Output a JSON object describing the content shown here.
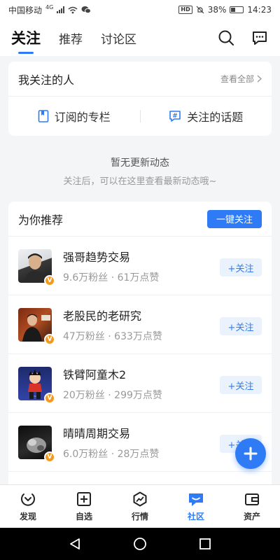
{
  "status_bar": {
    "carrier": "中国移动",
    "network": "4G",
    "battery": "38%",
    "battery_level": 0.38,
    "time": "14:23",
    "hd": "HD"
  },
  "top_nav": {
    "tabs": [
      {
        "label": "关注",
        "active": true
      },
      {
        "label": "推荐",
        "active": false
      },
      {
        "label": "讨论区",
        "active": false
      }
    ],
    "icons": [
      "search-icon",
      "message-icon"
    ]
  },
  "following": {
    "title": "我关注的人",
    "view_all": "查看全部",
    "links": [
      {
        "label": "订阅的专栏",
        "icon": "bookmark-icon"
      },
      {
        "label": "关注的话题",
        "icon": "hashtag-icon"
      }
    ]
  },
  "empty_state": {
    "title": "暂无更新动态",
    "subtitle": "关注后，可以在这里查看最新动态哦~"
  },
  "recommend": {
    "title": "为你推荐",
    "follow_all": "一键关注",
    "items": [
      {
        "name": "强哥趋势交易",
        "stats": "9.6万粉丝 · 61万点赞",
        "follow": "+关注",
        "badge": "V"
      },
      {
        "name": "老股民的老研究",
        "stats": "47万粉丝 · 633万点赞",
        "follow": "+关注",
        "badge": "V"
      },
      {
        "name": "铁臂阿童木2",
        "stats": "20万粉丝 · 299万点赞",
        "follow": "+关注",
        "badge": "V"
      },
      {
        "name": "晴晴周期交易",
        "stats": "6.0万粉丝 · 28万点赞",
        "follow": "+关注",
        "badge": "V"
      }
    ]
  },
  "bottom_nav": {
    "items": [
      {
        "label": "发现",
        "icon": "discover-icon",
        "active": false
      },
      {
        "label": "自选",
        "icon": "watchlist-icon",
        "active": false
      },
      {
        "label": "行情",
        "icon": "market-icon",
        "active": false
      },
      {
        "label": "社区",
        "icon": "community-icon",
        "active": true
      },
      {
        "label": "资产",
        "icon": "wallet-icon",
        "active": false
      }
    ]
  },
  "colors": {
    "accent": "#2f7bf5",
    "badge": "#f39a1e",
    "background": "#f4f5f7"
  }
}
